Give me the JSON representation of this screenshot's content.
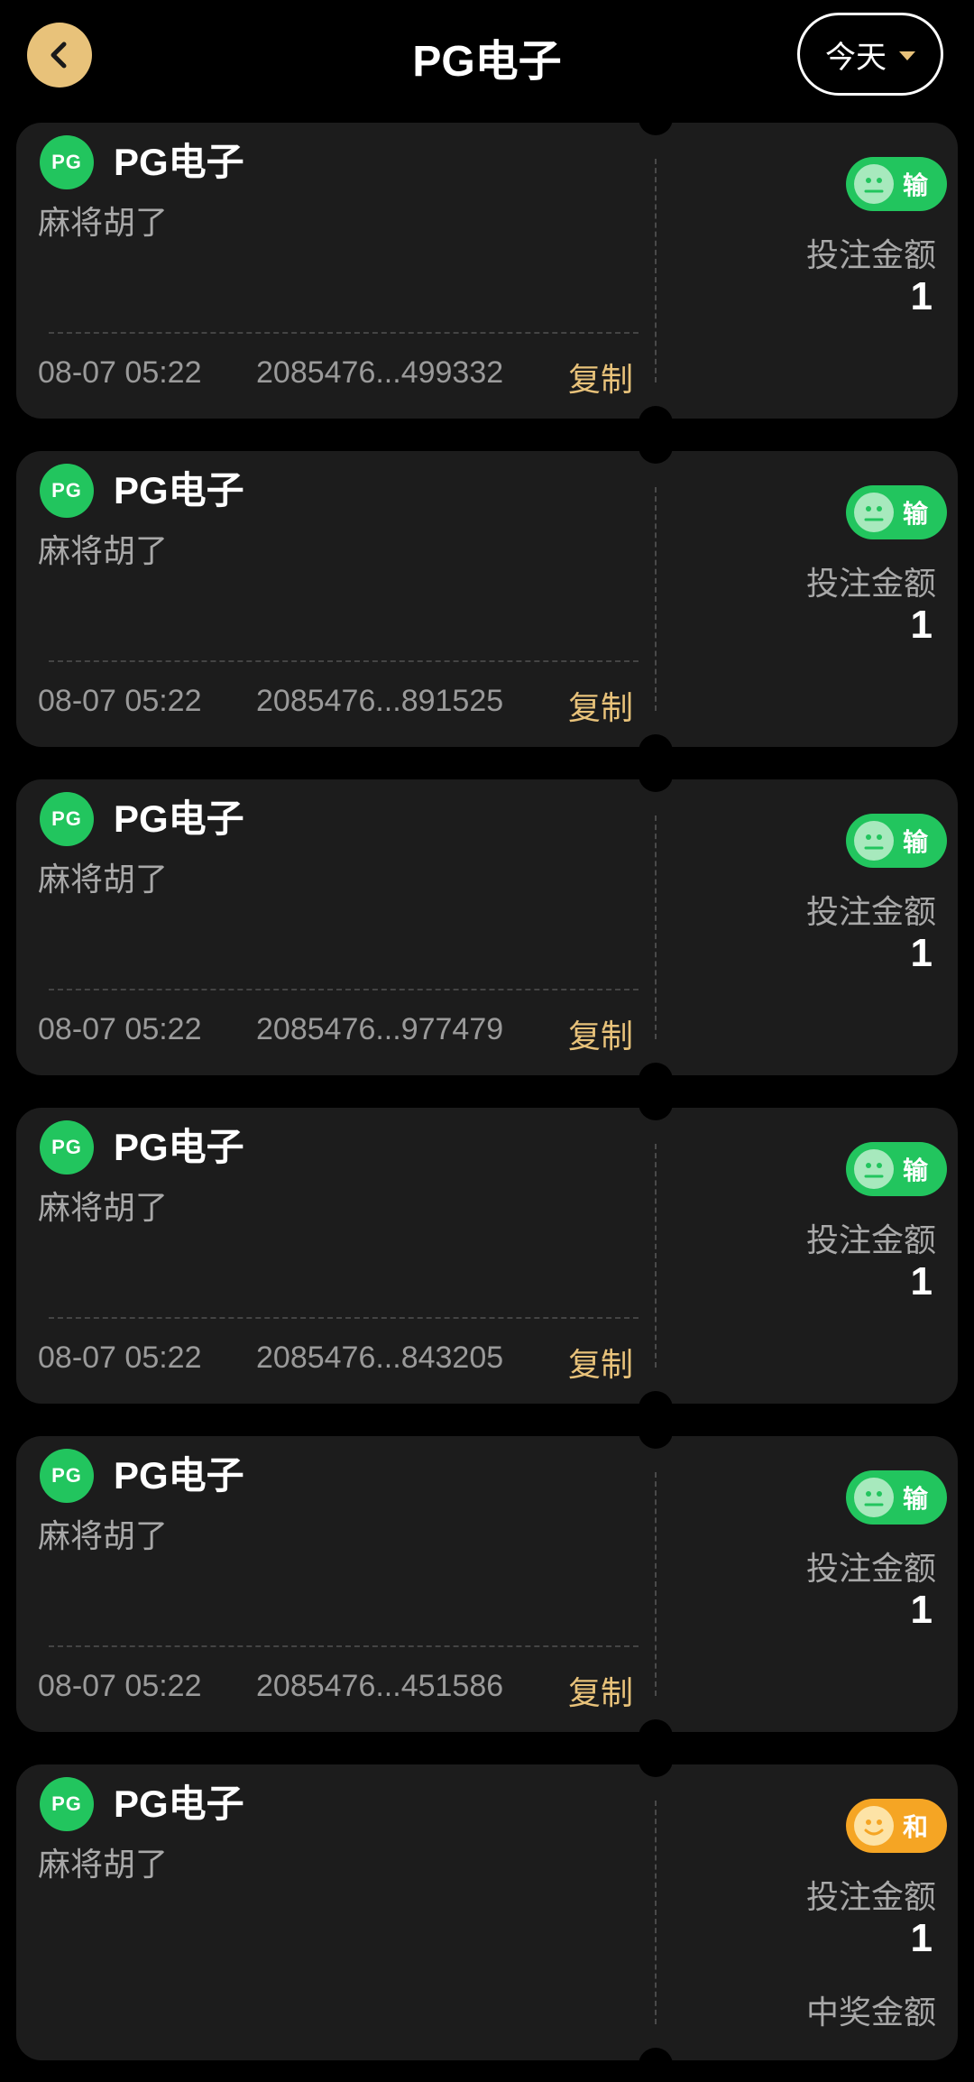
{
  "header": {
    "title": "PG电子",
    "filter_label": "今天"
  },
  "colors": {
    "accent": "#e8c27a",
    "lose": "#22c55e",
    "draw": "#f5a524",
    "card_bg": "#1c1c1c"
  },
  "records": [
    {
      "provider": "PG电子",
      "logo_text": "PG",
      "game": "麻将胡了",
      "time": "08-07 05:22",
      "order_no": "2085476...499332",
      "copy_label": "复制",
      "result": "输",
      "result_type": "lose",
      "bet_label": "投注金额",
      "bet_amount": "1"
    },
    {
      "provider": "PG电子",
      "logo_text": "PG",
      "game": "麻将胡了",
      "time": "08-07 05:22",
      "order_no": "2085476...891525",
      "copy_label": "复制",
      "result": "输",
      "result_type": "lose",
      "bet_label": "投注金额",
      "bet_amount": "1"
    },
    {
      "provider": "PG电子",
      "logo_text": "PG",
      "game": "麻将胡了",
      "time": "08-07 05:22",
      "order_no": "2085476...977479",
      "copy_label": "复制",
      "result": "输",
      "result_type": "lose",
      "bet_label": "投注金额",
      "bet_amount": "1"
    },
    {
      "provider": "PG电子",
      "logo_text": "PG",
      "game": "麻将胡了",
      "time": "08-07 05:22",
      "order_no": "2085476...843205",
      "copy_label": "复制",
      "result": "输",
      "result_type": "lose",
      "bet_label": "投注金额",
      "bet_amount": "1"
    },
    {
      "provider": "PG电子",
      "logo_text": "PG",
      "game": "麻将胡了",
      "time": "08-07 05:22",
      "order_no": "2085476...451586",
      "copy_label": "复制",
      "result": "输",
      "result_type": "lose",
      "bet_label": "投注金额",
      "bet_amount": "1"
    },
    {
      "provider": "PG电子",
      "logo_text": "PG",
      "game": "麻将胡了",
      "result": "和",
      "result_type": "draw",
      "bet_label": "投注金额",
      "bet_amount": "1",
      "prize_label": "中奖金额"
    }
  ]
}
